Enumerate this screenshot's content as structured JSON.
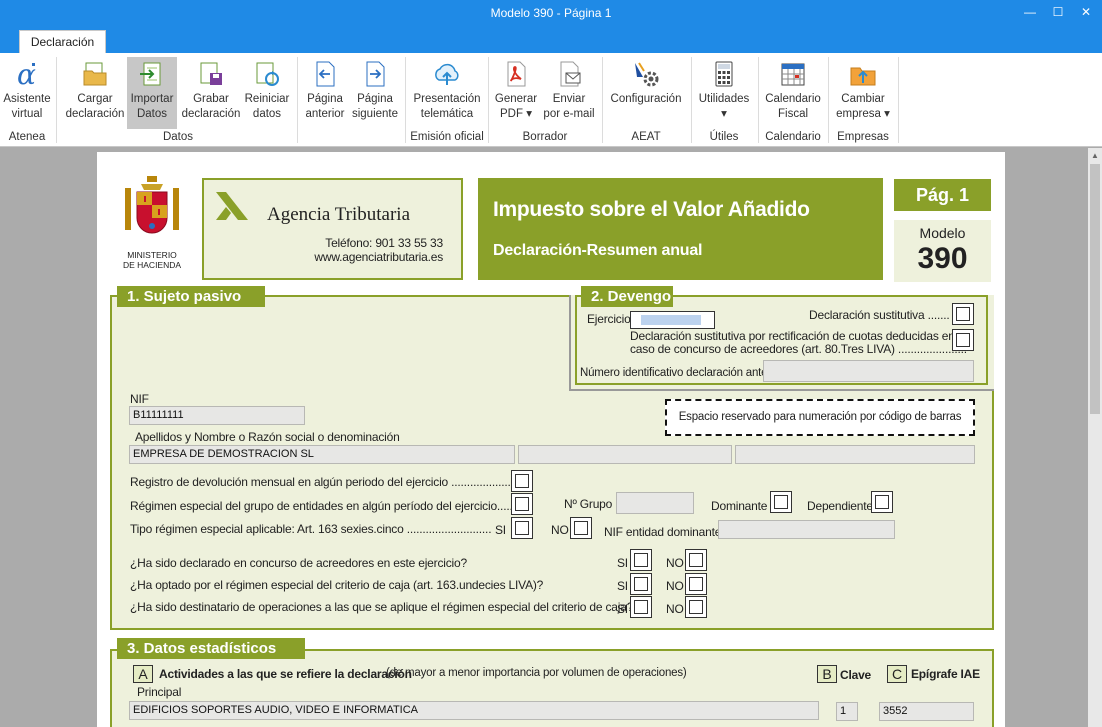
{
  "window": {
    "title": "Modelo 390 - Página 1"
  },
  "tabs": [
    {
      "label": "Declaración"
    }
  ],
  "ribbon": {
    "groups": [
      {
        "label": "Atenea"
      },
      {
        "label": "Datos"
      },
      {
        "label": "Emisión oficial"
      },
      {
        "label": "Borrador"
      },
      {
        "label": "AEAT"
      },
      {
        "label": "Útiles"
      },
      {
        "label": "Calendario"
      },
      {
        "label": "Empresas"
      }
    ],
    "buttons": [
      {
        "line1": "Asistente",
        "line2": "virtual",
        "icon": "alpha-assistant-icon"
      },
      {
        "line1": "Cargar",
        "line2": "declaración",
        "icon": "load-folder-icon"
      },
      {
        "line1": "Importar",
        "line2": "Datos",
        "icon": "import-data-icon"
      },
      {
        "line1": "Grabar",
        "line2": "declaración",
        "icon": "save-icon"
      },
      {
        "line1": "Reiniciar",
        "line2": "datos",
        "icon": "reset-icon"
      },
      {
        "line1": "Página",
        "line2": "anterior",
        "icon": "previous-page-icon"
      },
      {
        "line1": "Página",
        "line2": "siguiente",
        "icon": "next-page-icon"
      },
      {
        "line1": "Presentación",
        "line2": "telemática",
        "icon": "cloud-upload-icon"
      },
      {
        "line1": "Generar",
        "line2": "PDF",
        "icon": "pdf-icon"
      },
      {
        "line1": "Enviar",
        "line2": "por e-mail",
        "icon": "email-icon"
      },
      {
        "line1": "Configuración",
        "line2": "",
        "icon": "settings-icon"
      },
      {
        "line1": "Utilidades",
        "line2": "",
        "icon": "calculator-icon"
      },
      {
        "line1": "Calendario",
        "line2": "Fiscal",
        "icon": "calendar-icon"
      },
      {
        "line1": "Cambiar",
        "line2": "empresa",
        "icon": "change-company-icon"
      }
    ]
  },
  "form": {
    "ministry": {
      "line1": "MINISTERIO",
      "line2": "DE HACIENDA"
    },
    "agency": {
      "name": "Agencia Tributaria",
      "phone": "Teléfono: 901 33 55 33",
      "web": "www.agenciatributaria.es"
    },
    "heading": {
      "title": "Impuesto sobre el Valor Añadido",
      "subtitle": "Declaración-Resumen anual"
    },
    "page_tag": "Pág. 1",
    "modelo_label": "Modelo",
    "modelo_number": "390",
    "section1": {
      "title": "1. Sujeto pasivo",
      "nif_label": "NIF",
      "nif_value": "B11111111",
      "name_label": "Apellidos y Nombre o Razón social o denominación",
      "name_value": "EMPRESA DE DEMOSTRACION SL",
      "barcode_text": "Espacio reservado para numeración por código de barras",
      "reg_devolucion": "Registro de devolución mensual en algún periodo del ejercicio .....................",
      "reg_grupo": "Régimen especial del grupo de entidades en algún período del ejercicio.........",
      "n_grupo": "Nº Grupo",
      "dominante": "Dominante",
      "dependiente": "Dependiente",
      "tipo_regimen": "Tipo régimen especial aplicable: Art. 163 sexies.cinco ...........................",
      "si": "SI",
      "no": "NO",
      "nif_dominante": "NIF entidad dominante",
      "q1": "¿Ha sido declarado en concurso de acreedores en este ejercicio?",
      "q2": "¿Ha optado por el régimen especial del criterio de caja (art. 163.undecies LIVA)?",
      "q3": "¿Ha sido destinatario de operaciones a las que se aplique el régimen especial del criterio de caja?"
    },
    "section2": {
      "title": "2. Devengo",
      "ejercicio": "Ejercicio",
      "sustitutiva": "Declaración sustitutiva .......",
      "rect_line1": "Declaración sustitutiva por rectificación de cuotas deducidas en",
      "rect_line2": "caso de concurso de acreedores (art. 80.Tres LIVA) ......................",
      "num_anterior": "Número identificativo declaración anterior"
    },
    "section3": {
      "title": "3. Datos estadísticos",
      "letter_a": "A",
      "actividades_bold": "Actividades a las que se refiere la declaración",
      "actividades_rest": "(de mayor a menor importancia por volumen de operaciones)",
      "letter_b": "B",
      "clave": "Clave",
      "letter_c": "C",
      "epigrafe": "Epígrafe IAE",
      "principal": "Principal",
      "actividad_value": "EDIFICIOS SOPORTES AUDIO, VIDEO E INFORMATICA",
      "clave_value": "1",
      "epigrafe_value": "3552"
    }
  }
}
